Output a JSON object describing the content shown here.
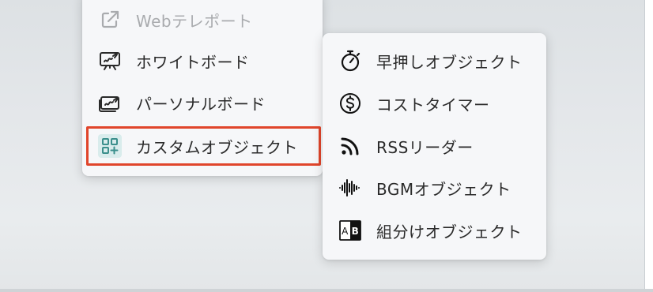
{
  "left_menu": {
    "items": [
      {
        "label": "Webテレポート",
        "icon": "external-link-icon",
        "disabled": true
      },
      {
        "label": "ホワイトボード",
        "icon": "whiteboard-icon",
        "disabled": false
      },
      {
        "label": "パーソナルボード",
        "icon": "personal-board-icon",
        "disabled": false
      },
      {
        "label": "カスタムオブジェクト",
        "icon": "custom-object-icon",
        "disabled": false,
        "highlighted": true
      }
    ]
  },
  "right_menu": {
    "items": [
      {
        "label": "早押しオブジェクト",
        "icon": "stopwatch-icon"
      },
      {
        "label": "コストタイマー",
        "icon": "dollar-circle-icon"
      },
      {
        "label": "RSSリーダー",
        "icon": "rss-icon"
      },
      {
        "label": "BGMオブジェクト",
        "icon": "audio-wave-icon"
      },
      {
        "label": "組分けオブジェクト",
        "icon": "ab-group-icon"
      }
    ]
  },
  "colors": {
    "highlight_border": "#e0452b",
    "custom_icon_tile": "#d9ecec",
    "custom_icon_stroke": "#3b8f8c",
    "disabled_text": "#a9abae",
    "text": "#2a2a2a"
  }
}
